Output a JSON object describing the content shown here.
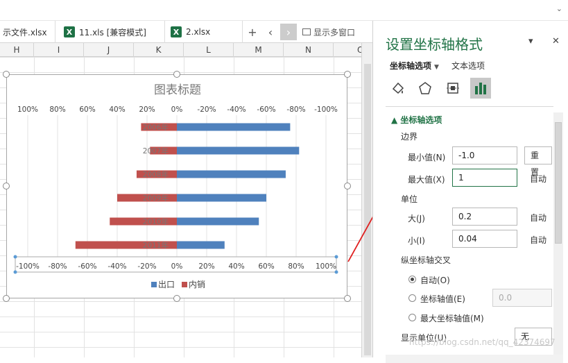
{
  "tabs": [
    {
      "label": "示文件.xlsx",
      "icon": "none"
    },
    {
      "label": "11.xls  [兼容模式]",
      "icon": "excel-icon"
    },
    {
      "label": "2.xlsx",
      "icon": "excel-icon"
    }
  ],
  "tab_controls": {
    "add": "+",
    "prev": "‹",
    "next": "›",
    "multi_window": "显示多窗口"
  },
  "columns": [
    "H",
    "I",
    "J",
    "K",
    "L",
    "M",
    "N",
    "O"
  ],
  "chart_data": {
    "type": "bar",
    "orientation": "horizontal",
    "title": "图表标题",
    "categories": [
      "2006年",
      "2007年",
      "2008年",
      "2009年",
      "2010年",
      "2011年"
    ],
    "series": [
      {
        "name": "出口",
        "color": "#4f81bd",
        "values": [
          0.76,
          0.82,
          0.73,
          0.6,
          0.55,
          0.32
        ]
      },
      {
        "name": "内销",
        "color": "#c0504d",
        "values": [
          -0.24,
          -0.18,
          -0.27,
          -0.4,
          -0.45,
          -0.68
        ]
      }
    ],
    "top_axis": {
      "ticks": [
        "100%",
        "80%",
        "60%",
        "40%",
        "20%",
        "0%",
        "-20%",
        "-40%",
        "-60%",
        "-80%",
        "-100%"
      ],
      "reversed": true
    },
    "bottom_axis": {
      "ticks": [
        "-100%",
        "-80%",
        "-60%",
        "-40%",
        "-20%",
        "0%",
        "20%",
        "40%",
        "60%",
        "80%",
        "100%"
      ]
    },
    "xlim": [
      -1.0,
      1.0
    ],
    "grid": true,
    "legend": "bottom"
  },
  "pane": {
    "title": "设置坐标轴格式",
    "dropdown": "▾",
    "close": "✕",
    "subtab_axis": "坐标轴选项",
    "subtab_text": "文本选项",
    "section": "坐标轴选项",
    "bounds": "边界",
    "min_label": "最小值(N)",
    "min_value": "-1.0",
    "reset": "重置",
    "max_label": "最大值(X)",
    "max_value": "1",
    "auto": "自动",
    "units": "单位",
    "major_label": "大(J)",
    "major_value": "0.2",
    "minor_label": "小(I)",
    "minor_value": "0.04",
    "cross": "纵坐标轴交叉",
    "radio_auto": "自动(O)",
    "radio_value": "坐标轴值(E)",
    "radio_value_field": "0.0",
    "radio_max": "最大坐标轴值(M)",
    "display_units": "显示单位(U)",
    "display_units_value": "无"
  },
  "watermark": "https://blog.csdn.net/qq_42374697"
}
